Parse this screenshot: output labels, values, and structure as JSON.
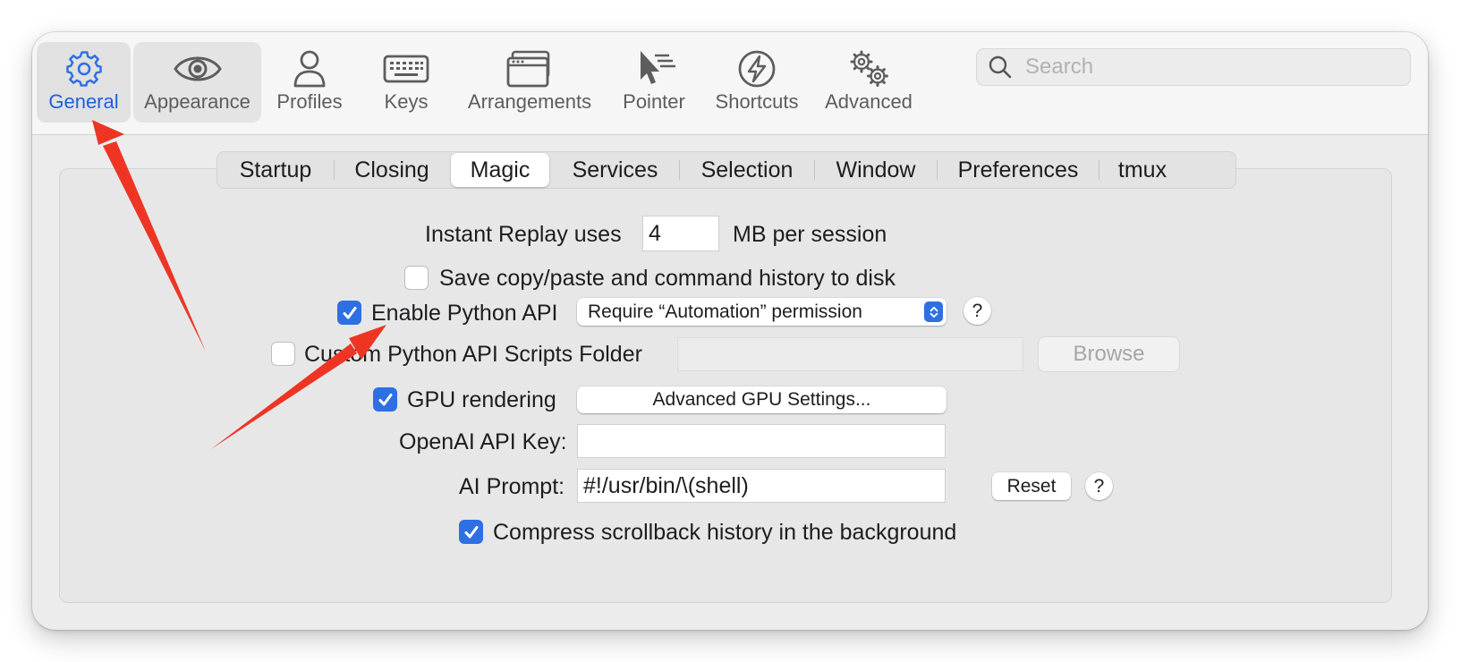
{
  "toolbar": {
    "items": [
      {
        "label": "General",
        "icon": "gear-icon",
        "selected": true
      },
      {
        "label": "Appearance",
        "icon": "eye-icon",
        "selected": false
      },
      {
        "label": "Profiles",
        "icon": "person-icon",
        "selected": false
      },
      {
        "label": "Keys",
        "icon": "keyboard-icon",
        "selected": false
      },
      {
        "label": "Arrangements",
        "icon": "windows-icon",
        "selected": false
      },
      {
        "label": "Pointer",
        "icon": "pointer-icon",
        "selected": false
      },
      {
        "label": "Shortcuts",
        "icon": "bolt-icon",
        "selected": false
      },
      {
        "label": "Advanced",
        "icon": "gears-icon",
        "selected": false
      }
    ],
    "search_placeholder": "Search"
  },
  "tabs": [
    "Startup",
    "Closing",
    "Magic",
    "Services",
    "Selection",
    "Window",
    "Preferences",
    "tmux"
  ],
  "active_tab": "Magic",
  "magic": {
    "instant_replay_label": "Instant Replay uses",
    "instant_replay_value": "4",
    "instant_replay_unit": "MB per session",
    "save_history_label": "Save copy/paste and command history to disk",
    "save_history_checked": false,
    "python_api_label": "Enable Python API",
    "python_api_checked": true,
    "python_api_permission": "Require “Automation” permission",
    "custom_scripts_label": "Custom Python API Scripts Folder",
    "custom_scripts_checked": false,
    "custom_scripts_path": "",
    "browse_label": "Browse",
    "gpu_label": "GPU rendering",
    "gpu_checked": true,
    "gpu_settings_label": "Advanced GPU Settings...",
    "openai_key_label": "OpenAI API Key:",
    "openai_key_value": "",
    "ai_prompt_label": "AI Prompt:",
    "ai_prompt_value": "#!/usr/bin/\\(shell)",
    "reset_label": "Reset",
    "help_label": "?",
    "compress_label": "Compress scrollback history in the background",
    "compress_checked": true
  },
  "colors": {
    "accent": "#2f6fe4",
    "selected_label": "#1f5fdd",
    "annotation_arrow": "#ee3524"
  }
}
